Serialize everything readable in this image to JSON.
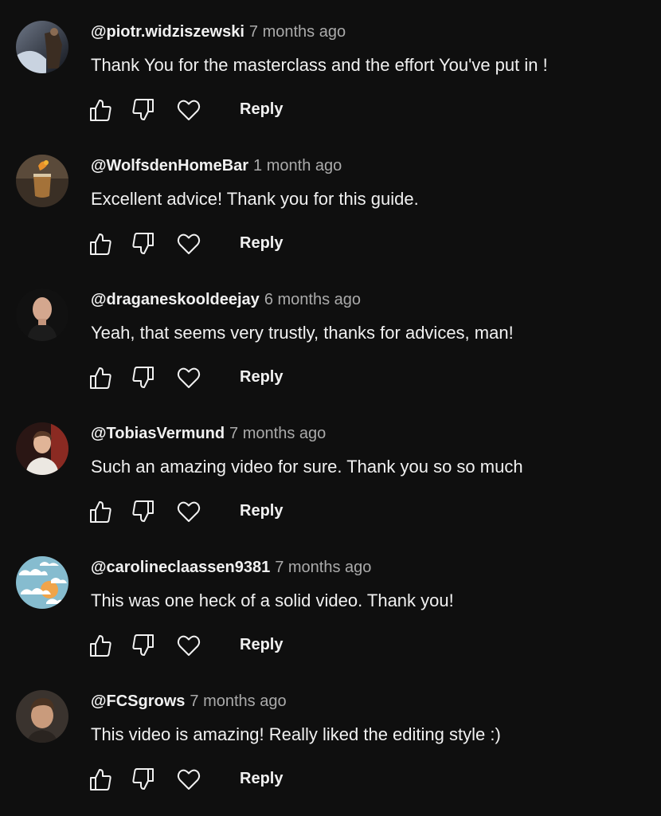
{
  "comments": [
    {
      "author": "@piotr.widziszewski",
      "time": "7 months ago",
      "text": "Thank You for the masterclass and the effort You've put in !",
      "reply_label": "Reply",
      "avatar_colors": [
        "#4a4f5a",
        "#1f2430"
      ]
    },
    {
      "author": "@WolfsdenHomeBar",
      "time": "1 month ago",
      "text": "Excellent advice!  Thank you for this guide.",
      "reply_label": "Reply",
      "avatar_colors": [
        "#8a6a42",
        "#2b241c"
      ]
    },
    {
      "author": "@draganeskooldeejay",
      "time": "6 months ago",
      "text": "Yeah, that seems very trustly, thanks for advices, man!",
      "reply_label": "Reply",
      "avatar_colors": [
        "#c89a82",
        "#1a1a1a"
      ]
    },
    {
      "author": "@TobiasVermund",
      "time": "7 months ago",
      "text": "Such an amazing video for sure. Thank you so so much",
      "reply_label": "Reply",
      "avatar_colors": [
        "#e8e4df",
        "#6b2a22"
      ]
    },
    {
      "author": "@carolineclaassen9381",
      "time": "7 months ago",
      "text": "This was one heck of a solid video. Thank you!",
      "reply_label": "Reply",
      "avatar_colors": [
        "#7fb3c9",
        "#f0a44a"
      ]
    },
    {
      "author": "@FCSgrows",
      "time": "7 months ago",
      "text": "This video is amazing! Really liked the editing style :)",
      "reply_label": "Reply",
      "avatar_colors": [
        "#b08a6e",
        "#3a3430"
      ]
    }
  ],
  "icons": {
    "like": "thumb-up-icon",
    "dislike": "thumb-down-icon",
    "heart": "heart-icon"
  },
  "colors": {
    "background": "#0f0f0f",
    "text": "#f1f1f1",
    "muted": "#aaaaaa"
  }
}
